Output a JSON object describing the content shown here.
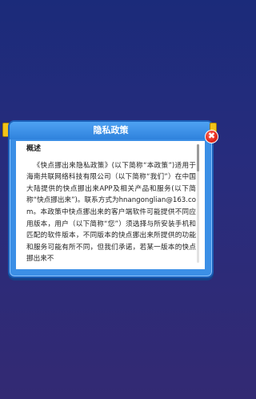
{
  "dialog": {
    "title": "隐私政策",
    "close_symbol": "✖",
    "section_heading": "概述",
    "body_text": "《快点挪出来隐私政策》(以下简称“本政策”)适用于海南共联网络科技有限公司（以下简称“我们”）在中国大陆提供的快点挪出来APP及相关产品和服务(以下简称“快点挪出来”)。联系方式为hnangonglian@163.com。本政策中快点挪出来的客户端软件可能提供不同应用版本，用户（以下简称“您”）须选择与所安装手机和匹配的软件版本，不同版本的快点挪出来所提供的功能和服务可能有所不同，但我们承诺，若某一版本的快点挪出来不"
  },
  "colors": {
    "background_top": "#1b2b7a",
    "dialog_blue": "#3b8fe6",
    "close_red": "#e2281c",
    "pin_yellow": "#f2c318"
  }
}
